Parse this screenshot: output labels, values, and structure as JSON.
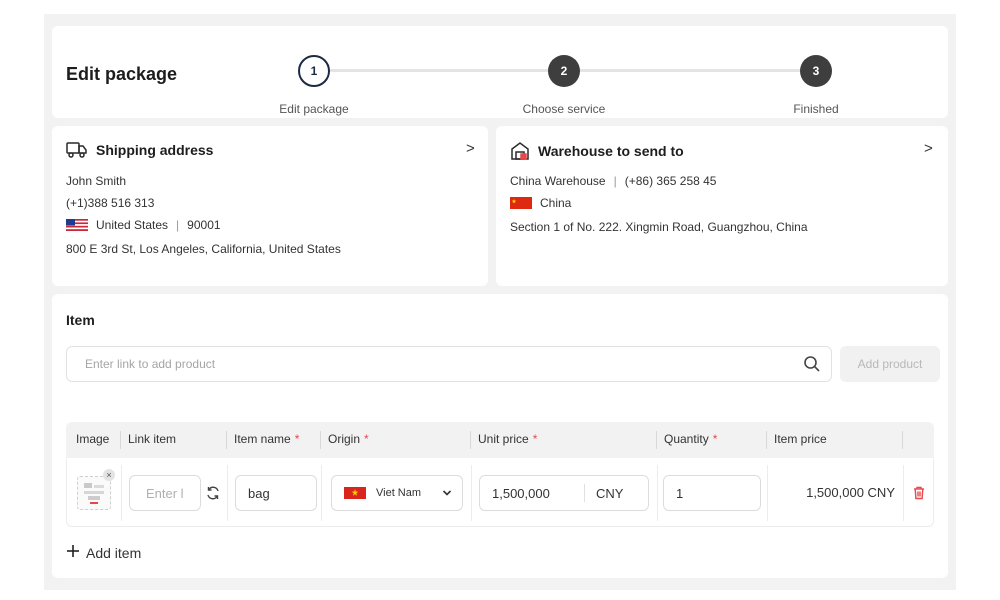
{
  "header": {
    "title": "Edit package",
    "steps": [
      {
        "number": "1",
        "label": "Edit package",
        "state": "active"
      },
      {
        "number": "2",
        "label": "Choose service",
        "state": "pending"
      },
      {
        "number": "3",
        "label": "Finished",
        "state": "pending"
      }
    ]
  },
  "shipping": {
    "title": "Shipping address",
    "icon": "truck-icon",
    "name": "John Smith",
    "phone": "(+1)388 516 313",
    "country": "United States",
    "zip": "90001",
    "address": "800 E 3rd St, Los Angeles, California, United States",
    "chevron": ">"
  },
  "warehouse": {
    "title": "Warehouse to send to",
    "icon": "warehouse-icon",
    "name": "China Warehouse",
    "phone": "(+86) 365 258 45",
    "country": "China",
    "address": "Section 1 of No. 222. Xingmin Road, Guangzhou, China",
    "chevron": ">"
  },
  "items": {
    "title": "Item",
    "search_placeholder": "Enter link to add product",
    "add_product_label": "Add product",
    "columns": [
      {
        "label": "Image",
        "required": false
      },
      {
        "label": "Link item",
        "required": false
      },
      {
        "label": "Item name",
        "required": true
      },
      {
        "label": "Origin",
        "required": true
      },
      {
        "label": "Unit price",
        "required": true
      },
      {
        "label": "Quantity",
        "required": true
      },
      {
        "label": "Item price",
        "required": false
      }
    ],
    "required_mark": "*",
    "rows": [
      {
        "link_placeholder": "Enter l",
        "item_name": "bag",
        "origin": "Viet Nam",
        "unit_price": "1,500,000",
        "currency": "CNY",
        "quantity": "1",
        "item_price": "1,500,000 CNY"
      }
    ],
    "add_item_label": "Add item"
  },
  "colors": {
    "accent_dark": "#1e2a44",
    "step_done": "#3e3e3e",
    "required": "#e8474b",
    "delete": "#e8474b",
    "background": "#f2f2f3"
  }
}
